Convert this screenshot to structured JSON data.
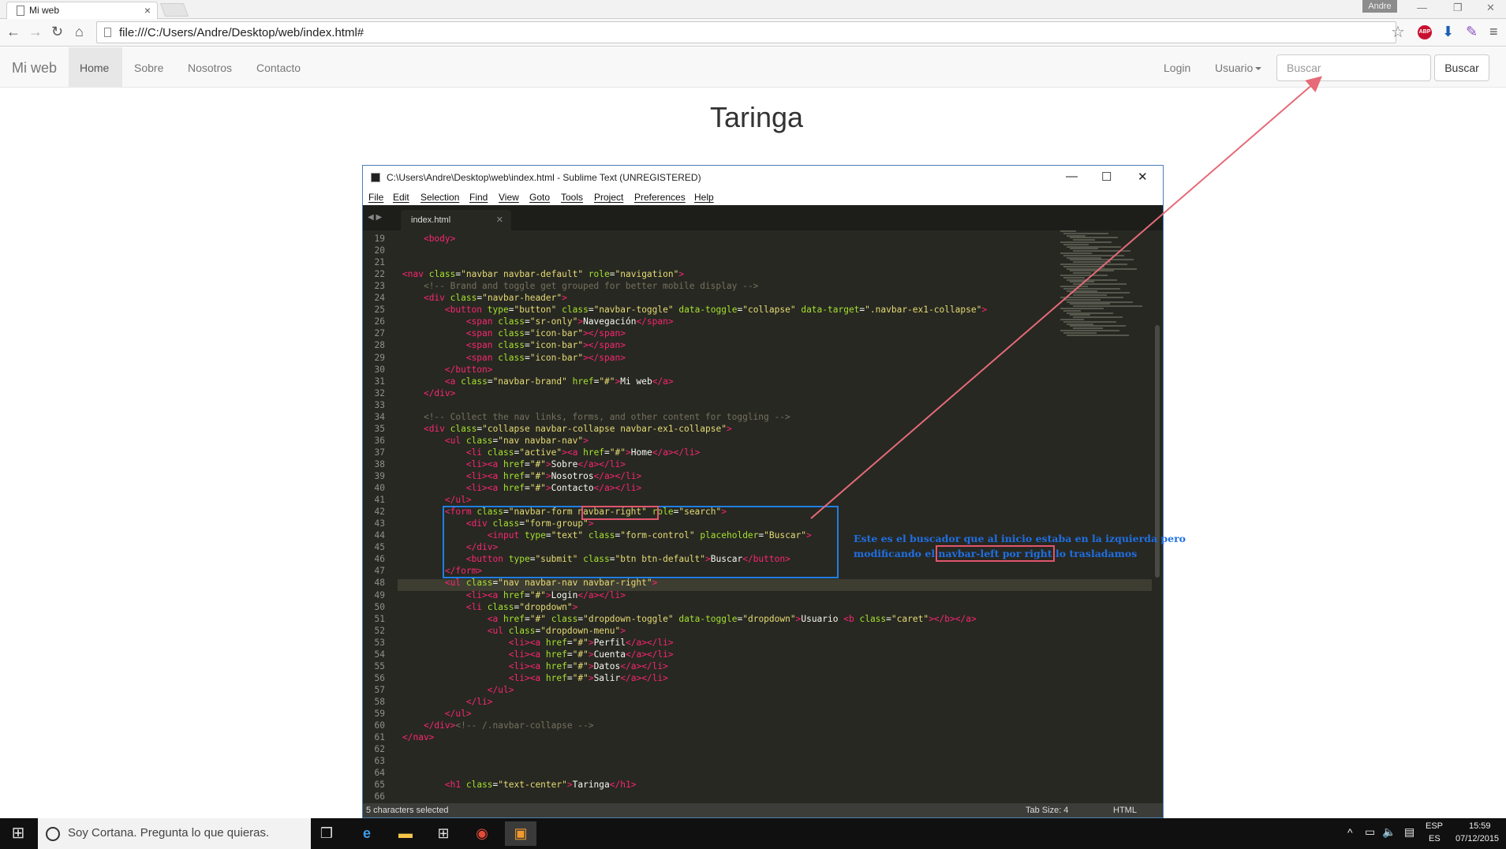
{
  "browser": {
    "tab_title": "Mi web",
    "tab_close": "×",
    "user_chip": "Andre",
    "url": "file:///C:/Users/Andre/Desktop/web/index.html#",
    "abp": "ABP"
  },
  "navbar": {
    "brand": "Mi web",
    "items": [
      "Home",
      "Sobre",
      "Nosotros",
      "Contacto"
    ],
    "login": "Login",
    "usuario": "Usuario",
    "search_placeholder": "Buscar",
    "search_button": "Buscar"
  },
  "page": {
    "heading": "Taringa"
  },
  "editor": {
    "title": "C:\\Users\\Andre\\Desktop\\web\\index.html - Sublime Text (UNREGISTERED)",
    "menu": [
      "File",
      "Edit",
      "Selection",
      "Find",
      "View",
      "Goto",
      "Tools",
      "Project",
      "Preferences",
      "Help"
    ],
    "tab": "index.html",
    "status_left": "5 characters selected",
    "status_tab": "Tab Size: 4",
    "status_syntax": "HTML",
    "lines": [
      {
        "n": "19",
        "html": "    <span class=tg>&lt;body&gt;</span>"
      },
      {
        "n": "20",
        "html": ""
      },
      {
        "n": "21",
        "html": ""
      },
      {
        "n": "22",
        "html": "<span class=tg>&lt;nav</span> <span class=at>class</span>=<span class=st>\"navbar navbar-default\"</span> <span class=at>role</span>=<span class=st>\"navigation\"</span><span class=tg>&gt;</span>"
      },
      {
        "n": "23",
        "html": "    <span class=cm>&lt;!-- Brand and toggle get grouped for better mobile display --&gt;</span>"
      },
      {
        "n": "24",
        "html": "    <span class=tg>&lt;div</span> <span class=at>class</span>=<span class=st>\"navbar-header\"</span><span class=tg>&gt;</span>"
      },
      {
        "n": "25",
        "html": "        <span class=tg>&lt;button</span> <span class=at>type</span>=<span class=st>\"button\"</span> <span class=at>class</span>=<span class=st>\"navbar-toggle\"</span> <span class=at>data-toggle</span>=<span class=st>\"collapse\"</span> <span class=at>data-target</span>=<span class=st>\".navbar-ex1-collapse\"</span><span class=tg>&gt;</span>"
      },
      {
        "n": "26",
        "html": "            <span class=tg>&lt;span</span> <span class=at>class</span>=<span class=st>\"sr-only\"</span><span class=tg>&gt;</span>Navegación<span class=tg>&lt;/span&gt;</span>"
      },
      {
        "n": "27",
        "html": "            <span class=tg>&lt;span</span> <span class=at>class</span>=<span class=st>\"icon-bar\"</span><span class=tg>&gt;&lt;/span&gt;</span>"
      },
      {
        "n": "28",
        "html": "            <span class=tg>&lt;span</span> <span class=at>class</span>=<span class=st>\"icon-bar\"</span><span class=tg>&gt;&lt;/span&gt;</span>"
      },
      {
        "n": "29",
        "html": "            <span class=tg>&lt;span</span> <span class=at>class</span>=<span class=st>\"icon-bar\"</span><span class=tg>&gt;&lt;/span&gt;</span>"
      },
      {
        "n": "30",
        "html": "        <span class=tg>&lt;/button&gt;</span>"
      },
      {
        "n": "31",
        "html": "        <span class=tg>&lt;a</span> <span class=at>class</span>=<span class=st>\"navbar-brand\"</span> <span class=at>href</span>=<span class=st>\"#\"</span><span class=tg>&gt;</span>Mi web<span class=tg>&lt;/a&gt;</span>"
      },
      {
        "n": "32",
        "html": "    <span class=tg>&lt;/div&gt;</span>"
      },
      {
        "n": "33",
        "html": ""
      },
      {
        "n": "34",
        "html": "    <span class=cm>&lt;!-- Collect the nav links, forms, and other content for toggling --&gt;</span>"
      },
      {
        "n": "35",
        "html": "    <span class=tg>&lt;div</span> <span class=at>class</span>=<span class=st>\"collapse navbar-collapse navbar-ex1-collapse\"</span><span class=tg>&gt;</span>"
      },
      {
        "n": "36",
        "html": "        <span class=tg>&lt;ul</span> <span class=at>class</span>=<span class=st>\"nav navbar-nav\"</span><span class=tg>&gt;</span>"
      },
      {
        "n": "37",
        "html": "            <span class=tg>&lt;li</span> <span class=at>class</span>=<span class=st>\"active\"</span><span class=tg>&gt;&lt;a</span> <span class=at>href</span>=<span class=st>\"#\"</span><span class=tg>&gt;</span>Home<span class=tg>&lt;/a&gt;&lt;/li&gt;</span>"
      },
      {
        "n": "38",
        "html": "            <span class=tg>&lt;li&gt;&lt;a</span> <span class=at>href</span>=<span class=st>\"#\"</span><span class=tg>&gt;</span>Sobre<span class=tg>&lt;/a&gt;&lt;/li&gt;</span>"
      },
      {
        "n": "39",
        "html": "            <span class=tg>&lt;li&gt;&lt;a</span> <span class=at>href</span>=<span class=st>\"#\"</span><span class=tg>&gt;</span>Nosotros<span class=tg>&lt;/a&gt;&lt;/li&gt;</span>"
      },
      {
        "n": "40",
        "html": "            <span class=tg>&lt;li&gt;&lt;a</span> <span class=at>href</span>=<span class=st>\"#\"</span><span class=tg>&gt;</span>Contacto<span class=tg>&lt;/a&gt;&lt;/li&gt;</span>"
      },
      {
        "n": "41",
        "html": "        <span class=tg>&lt;/ul&gt;</span>"
      },
      {
        "n": "42",
        "html": "        <span class=tg>&lt;form</span> <span class=at>class</span>=<span class=st>\"navbar-form navbar-right\"</span> <span class=at>role</span>=<span class=st>\"search\"</span><span class=tg>&gt;</span>"
      },
      {
        "n": "43",
        "html": "            <span class=tg>&lt;div</span> <span class=at>class</span>=<span class=st>\"form-group\"</span><span class=tg>&gt;</span>"
      },
      {
        "n": "44",
        "html": "                <span class=tg>&lt;input</span> <span class=at>type</span>=<span class=st>\"text\"</span> <span class=at>class</span>=<span class=st>\"form-control\"</span> <span class=at>placeholder</span>=<span class=st>\"Buscar\"</span><span class=tg>&gt;</span>"
      },
      {
        "n": "45",
        "html": "            <span class=tg>&lt;/div&gt;</span>"
      },
      {
        "n": "46",
        "html": "            <span class=tg>&lt;button</span> <span class=at>type</span>=<span class=st>\"submit\"</span> <span class=at>class</span>=<span class=st>\"btn btn-default\"</span><span class=tg>&gt;</span>Buscar<span class=tg>&lt;/button&gt;</span>"
      },
      {
        "n": "47",
        "html": "        <span class=tg>&lt;/form&gt;</span>"
      },
      {
        "n": "48",
        "html": "        <span class=tg>&lt;ul</span> <span class=at>class</span>=<span class=st>\"nav navbar-nav navbar-right\"</span><span class=tg>&gt;</span>"
      },
      {
        "n": "49",
        "html": "            <span class=tg>&lt;li&gt;&lt;a</span> <span class=at>href</span>=<span class=st>\"#\"</span><span class=tg>&gt;</span>Login<span class=tg>&lt;/a&gt;&lt;/li&gt;</span>"
      },
      {
        "n": "50",
        "html": "            <span class=tg>&lt;li</span> <span class=at>class</span>=<span class=st>\"dropdown\"</span><span class=tg>&gt;</span>"
      },
      {
        "n": "51",
        "html": "                <span class=tg>&lt;a</span> <span class=at>href</span>=<span class=st>\"#\"</span> <span class=at>class</span>=<span class=st>\"dropdown-toggle\"</span> <span class=at>data-toggle</span>=<span class=st>\"dropdown\"</span><span class=tg>&gt;</span>Usuario <span class=tg>&lt;b</span> <span class=at>class</span>=<span class=st>\"caret\"</span><span class=tg>&gt;&lt;/b&gt;&lt;/a&gt;</span>"
      },
      {
        "n": "52",
        "html": "                <span class=tg>&lt;ul</span> <span class=at>class</span>=<span class=st>\"dropdown-menu\"</span><span class=tg>&gt;</span>"
      },
      {
        "n": "53",
        "html": "                    <span class=tg>&lt;li&gt;&lt;a</span> <span class=at>href</span>=<span class=st>\"#\"</span><span class=tg>&gt;</span>Perfil<span class=tg>&lt;/a&gt;&lt;/li&gt;</span>"
      },
      {
        "n": "54",
        "html": "                    <span class=tg>&lt;li&gt;&lt;a</span> <span class=at>href</span>=<span class=st>\"#\"</span><span class=tg>&gt;</span>Cuenta<span class=tg>&lt;/a&gt;&lt;/li&gt;</span>"
      },
      {
        "n": "55",
        "html": "                    <span class=tg>&lt;li&gt;&lt;a</span> <span class=at>href</span>=<span class=st>\"#\"</span><span class=tg>&gt;</span>Datos<span class=tg>&lt;/a&gt;&lt;/li&gt;</span>"
      },
      {
        "n": "56",
        "html": "                    <span class=tg>&lt;li&gt;&lt;a</span> <span class=at>href</span>=<span class=st>\"#\"</span><span class=tg>&gt;</span>Salir<span class=tg>&lt;/a&gt;&lt;/li&gt;</span>"
      },
      {
        "n": "57",
        "html": "                <span class=tg>&lt;/ul&gt;</span>"
      },
      {
        "n": "58",
        "html": "            <span class=tg>&lt;/li&gt;</span>"
      },
      {
        "n": "59",
        "html": "        <span class=tg>&lt;/ul&gt;</span>"
      },
      {
        "n": "60",
        "html": "    <span class=tg>&lt;/div&gt;</span><span class=cm>&lt;!-- /.navbar-collapse --&gt;</span>"
      },
      {
        "n": "61",
        "html": "<span class=tg>&lt;/nav&gt;</span>"
      },
      {
        "n": "62",
        "html": ""
      },
      {
        "n": "63",
        "html": ""
      },
      {
        "n": "64",
        "html": ""
      },
      {
        "n": "65",
        "html": "        <span class=tg>&lt;h1</span> <span class=at>class</span>=<span class=st>\"text-center\"</span><span class=tg>&gt;</span>Taringa<span class=tg>&lt;/h1&gt;</span>"
      },
      {
        "n": "66",
        "html": ""
      }
    ]
  },
  "annotation": {
    "line1": "Este es el buscador que al inicio estaba en la izquierda pero",
    "line2_prefix": "modificando el ",
    "line2_highlight": "navbar-left por right",
    "line2_suffix": " lo trasladamos",
    "colors": {
      "arrow": "#e66a78",
      "box_red": "#e0566d",
      "box_blue": "#1f7fe2",
      "text": "#1f6fe2"
    }
  },
  "taskbar": {
    "cortana_placeholder": "Soy Cortana. Pregunta lo que quieras.",
    "lang_top": "ESP",
    "lang_bottom": "ES",
    "time": "15:59",
    "date": "07/12/2015"
  }
}
